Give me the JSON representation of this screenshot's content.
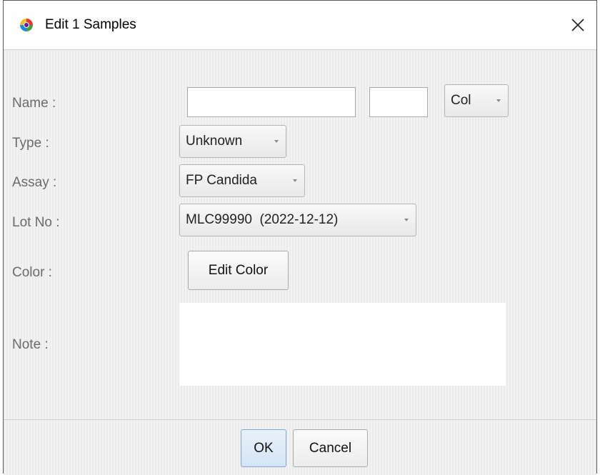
{
  "window": {
    "title": "Edit 1 Samples",
    "close_icon": "close-icon",
    "app_icon": "app-logo-icon"
  },
  "form": {
    "name": {
      "label": "Name :",
      "value": "",
      "suffix_value": "",
      "combo_value": "Col"
    },
    "type": {
      "label": "Type :",
      "value": "Unknown"
    },
    "assay": {
      "label": "Assay :",
      "value": "FP Candida"
    },
    "lot": {
      "label": "Lot No :",
      "value": "MLC99990  (2022-12-12)"
    },
    "color": {
      "label": "Color :",
      "button_label": "Edit Color"
    },
    "note": {
      "label": "Note :",
      "value": ""
    }
  },
  "buttons": {
    "ok_label": "OK",
    "cancel_label": "Cancel"
  },
  "colors": {
    "ok_accent": "#7ea6d3",
    "label_text": "#6b6b6b"
  }
}
